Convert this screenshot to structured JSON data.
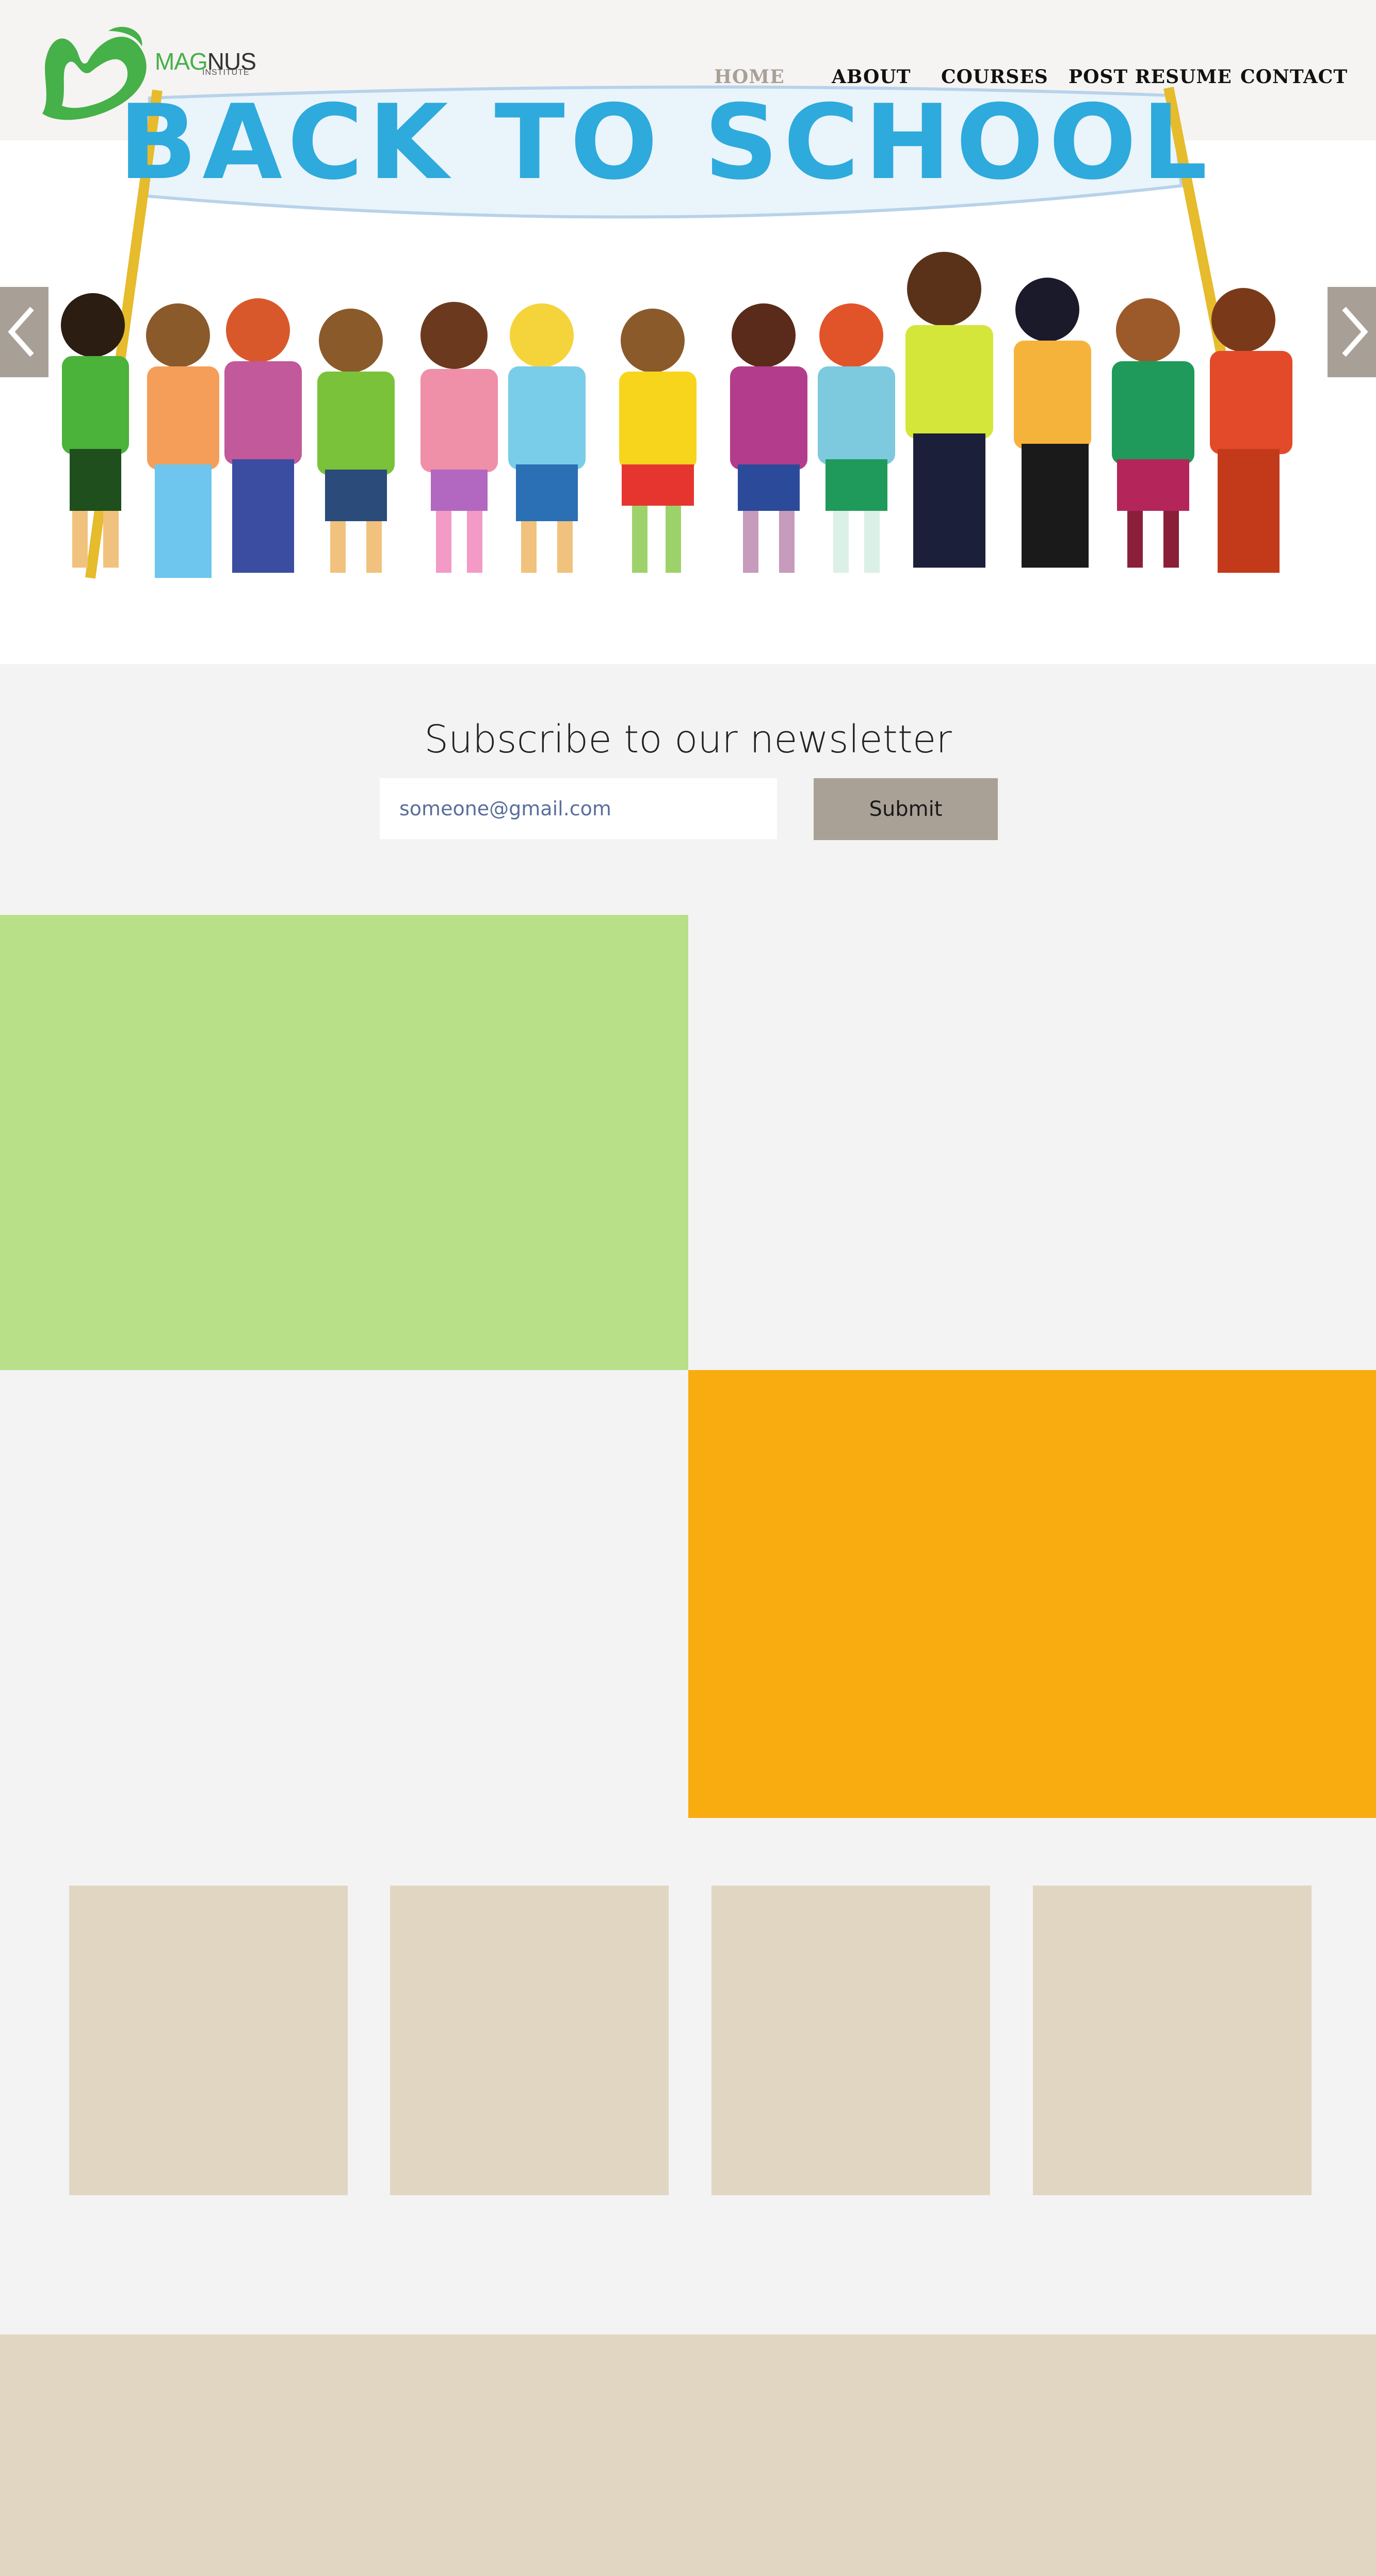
{
  "brand": {
    "name_part1": "MAG",
    "name_part2": "NUS",
    "sub": "INSTITUTE",
    "colors": {
      "green": "#46b049",
      "dark": "#333333"
    }
  },
  "nav": {
    "items": [
      {
        "label": "HOME",
        "active": true
      },
      {
        "label": "ABOUT",
        "active": false
      },
      {
        "label": "COURSES",
        "active": false
      },
      {
        "label": "POST RESUME",
        "active": false
      },
      {
        "label": "CONTACT",
        "active": false
      }
    ]
  },
  "hero": {
    "banner_text": "BACK TO SCHOOL",
    "prev_icon": "chevron-left-icon",
    "next_icon": "chevron-right-icon"
  },
  "newsletter": {
    "title": "Subscribe to our newsletter",
    "email_placeholder": "someone@gmail.com",
    "submit_label": "Submit"
  },
  "colors": {
    "header_bg": "#f5f4f3",
    "page_bg": "#f3f3f3",
    "green_block": "#b7e089",
    "orange_block": "#f9ac10",
    "card_bg": "#e0d6c2",
    "accent_gray": "#aaa196"
  }
}
